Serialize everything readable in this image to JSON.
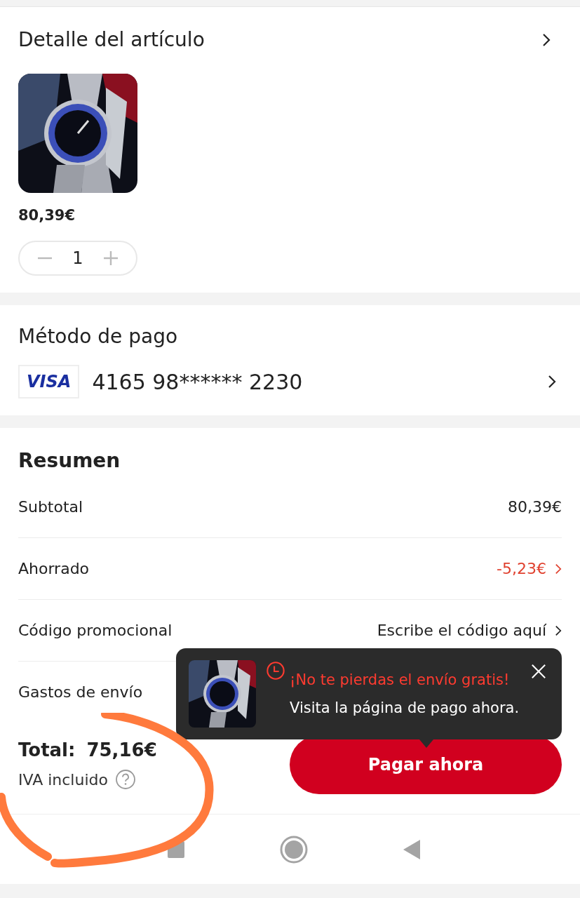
{
  "item_detail": {
    "title": "Detalle del artículo",
    "price": "80,39€",
    "quantity": "1"
  },
  "payment": {
    "title": "Método de pago",
    "card_brand": "VISA",
    "card_number": "4165 98****** 2230"
  },
  "summary": {
    "title": "Resumen",
    "rows": [
      {
        "kind": "plain",
        "label": "Subtotal",
        "value": "80,39€"
      },
      {
        "kind": "discount",
        "label": "Ahorrado",
        "value": "-5,23€"
      },
      {
        "kind": "input",
        "label": "Código promocional",
        "value": "Escribe el código aquí"
      },
      {
        "kind": "label_only",
        "label": "Gastos de envío"
      }
    ]
  },
  "footer": {
    "total_label": "Total:",
    "total": "75,16€",
    "tax_note": "IVA incluido",
    "button": "Pagar ahora"
  },
  "toast": {
    "alert": "¡No te pierdas el envío gratis!",
    "message": "Visita la página de pago ahora."
  }
}
